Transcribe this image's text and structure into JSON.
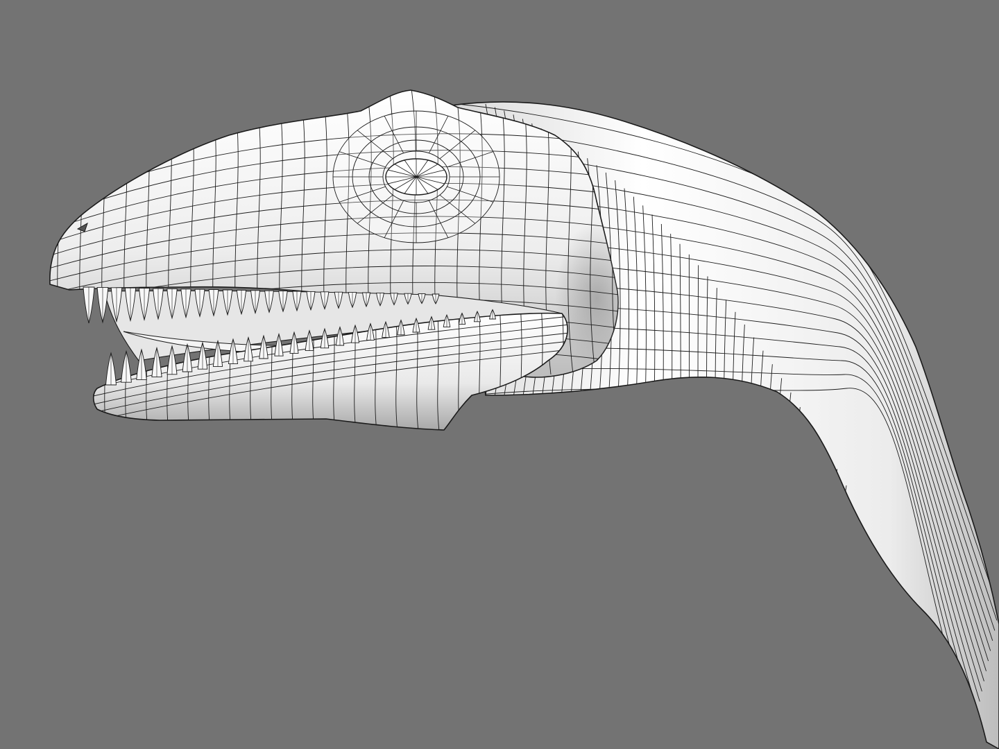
{
  "scene": {
    "subject": "dinosaur-head-wireframe-render",
    "background_color": "#737373",
    "surface_color": "#f2f2f2",
    "shade_color": "#8c8c8c",
    "wire_color": "#1a1a1a",
    "render_style": "shaded-wireframe"
  }
}
